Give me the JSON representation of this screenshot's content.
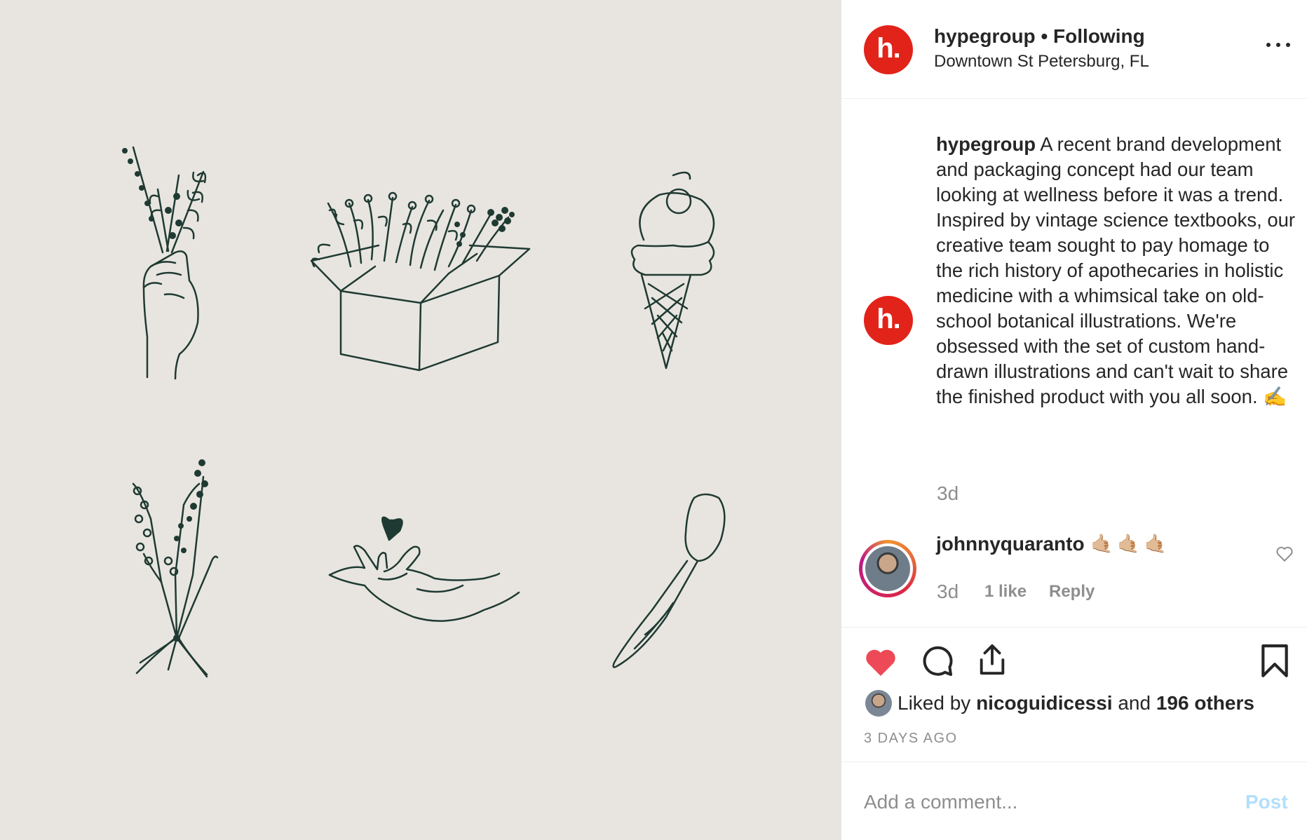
{
  "post": {
    "account": "hypegroup",
    "separator": "•",
    "following_label": "Following",
    "location": "Downtown St Petersburg, FL",
    "logo_letter": "h.",
    "brand_color": "#e2231a"
  },
  "caption": {
    "username": "hypegroup",
    "text": "A recent brand development and packaging concept had our team looking at wellness before it was a trend. Inspired by vintage science textbooks, our creative team sought to pay homage to the rich history of apothecaries in holistic medicine with a whimsical take on old-school botanical illustrations. We're obsessed with the set of custom hand-drawn illustrations and can't wait to share the finished product with you all soon. ✍️",
    "time": "3d"
  },
  "comment": {
    "username": "johnnyquaranto",
    "text": "🤙🏼🤙🏼🤙🏼",
    "time": "3d",
    "likes": "1 like",
    "reply_label": "Reply"
  },
  "likes": {
    "prefix": "Liked by",
    "first_liker": "nicoguidicessi",
    "connector": "and",
    "others": "196 others"
  },
  "timestamp": "3 DAYS AGO",
  "composer": {
    "placeholder": "Add a comment...",
    "post_label": "Post"
  },
  "icons": {
    "like": "heart-icon",
    "comment": "comment-icon",
    "share": "share-icon",
    "save": "bookmark-icon",
    "more": "more-options-icon"
  },
  "colors": {
    "liked_heart": "#ed4956",
    "illustration_ink": "#1f3a32",
    "post_button_disabled": "#b2dffc"
  }
}
